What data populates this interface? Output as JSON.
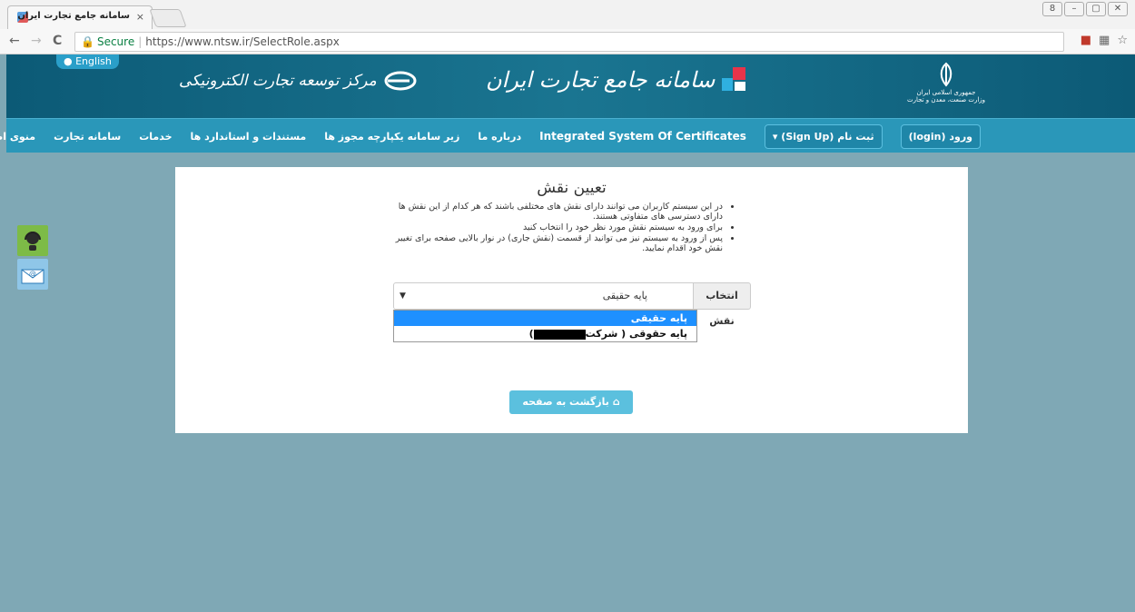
{
  "browser": {
    "tab_title": "سامانه جامع تجارت ایران",
    "tab_close": "×",
    "secure_label": "Secure",
    "url": "https://www.ntsw.ir/SelectRole.aspx",
    "lock_icon": "lock-icon",
    "back_icon": "←",
    "forward_icon": "→",
    "reload_icon": "C",
    "star_icon": "☆",
    "window_controls": [
      "8",
      "–",
      "▢",
      "✕"
    ]
  },
  "header": {
    "english_link": "English",
    "brand_left": "مرکز توسعه تجارت الکترونیکی",
    "brand_center": "سامانه جامع تجارت ایران",
    "brand_right_line1": "جمهوری اسلامی ایران",
    "brand_right_line2": "وزارت صنعت، معدن و تجارت"
  },
  "navbar": {
    "items": [
      "منوی اصلی",
      "سامانه تجارت",
      "خدمات",
      "مستندات و استاندارد ها",
      "زیر سامانه یکپارچه مجوز ها",
      "درباره ما",
      "Integrated System Of Certificates"
    ],
    "signup": "ثبت نام (Sign Up)",
    "login": "ورود (login)"
  },
  "main": {
    "title": "تعیین نقش",
    "instructions": [
      "در این سیستم کاربران می توانند دارای نقش های مختلفی باشند که هر کدام از این نقش ها دارای دسترسی های متفاوتی هستند.",
      "برای ورود به سیستم نقش مورد نظر خود را انتخاب کنید",
      "پس از ورود به سیستم نیز می توانید از قسمت (نقش جاری) در نوار بالایی صفحه برای تغییر نقش خود اقدام نمایید."
    ],
    "role_label": "انتخاب نقش",
    "role_selected": "پایه حقیقی",
    "role_options": [
      "پایه حقیقی",
      "پایه حقوقی ( شرکت",
      ")"
    ],
    "home_button": "بازگشت به صفحه اصلی"
  },
  "colors": {
    "header_bg": "#0e5f7a",
    "navbar_bg": "#2a97b9",
    "page_bg": "#7fa8b5",
    "highlight": "#1e90ff",
    "home_button": "#5bc0de"
  }
}
